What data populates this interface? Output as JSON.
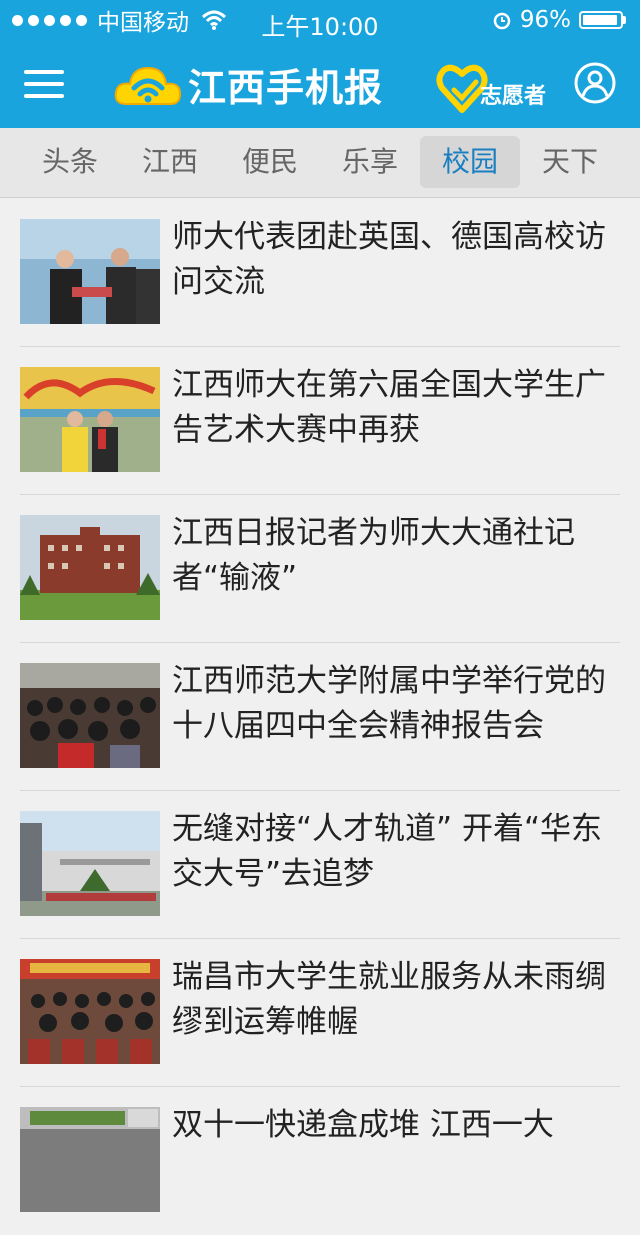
{
  "status": {
    "carrier": "中国移动",
    "time": "上午10:00",
    "battery": "96%",
    "battery_level": 0.96
  },
  "header": {
    "logo_text": "江西手机报",
    "volunteer_label": "志愿者",
    "brand_color": "#1aa4dd",
    "accent_color": "#ffd400"
  },
  "tabs": [
    {
      "label": "头条"
    },
    {
      "label": "江西"
    },
    {
      "label": "便民"
    },
    {
      "label": "乐享"
    },
    {
      "label": "校园",
      "active": true
    },
    {
      "label": "天下"
    }
  ],
  "articles": [
    {
      "title": "师大代表团赴英国、德国高校访问交流"
    },
    {
      "title": "江西师大在第六届全国大学生广告艺术大赛中再获"
    },
    {
      "title": "江西日报记者为师大大通社记者“输液”"
    },
    {
      "title": "江西师范大学附属中学举行党的十八届四中全会精神报告会"
    },
    {
      "title": "无缝对接“人才轨道” 开着“华东交大号”去追梦"
    },
    {
      "title": "瑞昌市大学生就业服务从未雨绸缪到运筹帷幄"
    },
    {
      "title": "双十一快递盒成堆 江西一大"
    }
  ],
  "icons": {
    "menu": "menu-icon",
    "logo": "cloud-wifi-logo-icon",
    "volunteer": "heart-hand-icon",
    "user": "user-icon",
    "wifi": "wifi-icon",
    "alarm": "alarm-icon",
    "battery": "battery-icon"
  }
}
